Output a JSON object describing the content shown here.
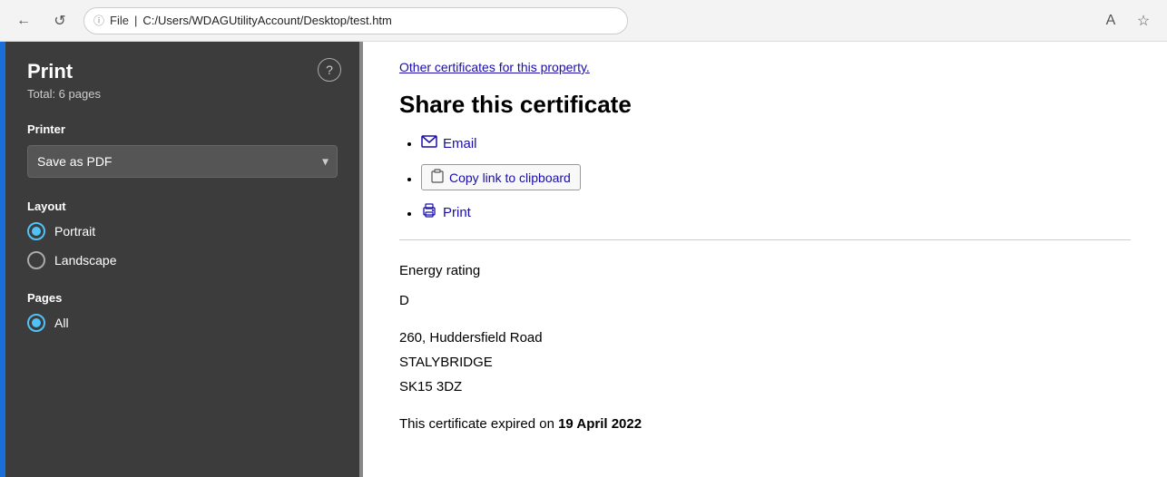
{
  "browser": {
    "back_btn": "←",
    "refresh_btn": "↺",
    "info_icon": "ⓘ",
    "file_label": "File",
    "address": "C:/Users/WDAGUtilityAccount/Desktop/test.htm",
    "translate_icon": "A",
    "favorite_icon": "☆"
  },
  "print_panel": {
    "title": "Print",
    "total_pages": "Total: 6 pages",
    "help_btn": "?",
    "printer_label": "Printer",
    "printer_value": "Save as PDF",
    "layout_label": "Layout",
    "portrait_label": "Portrait",
    "landscape_label": "Landscape",
    "pages_label": "Pages",
    "all_label": "All"
  },
  "page_content": {
    "other_certs_link": "Other certificates for this property.",
    "share_heading": "Share this certificate",
    "email_label": "Email",
    "copy_btn_label": "Copy link to clipboard",
    "print_label": "Print",
    "energy_rating_label": "Energy rating",
    "energy_rating_value": "D",
    "address_line1": "260, Huddersfield Road",
    "address_line2": "STALYBRIDGE",
    "address_line3": "SK15 3DZ",
    "expire_text_prefix": "This certificate expired on ",
    "expire_date": "19 April 2022"
  }
}
